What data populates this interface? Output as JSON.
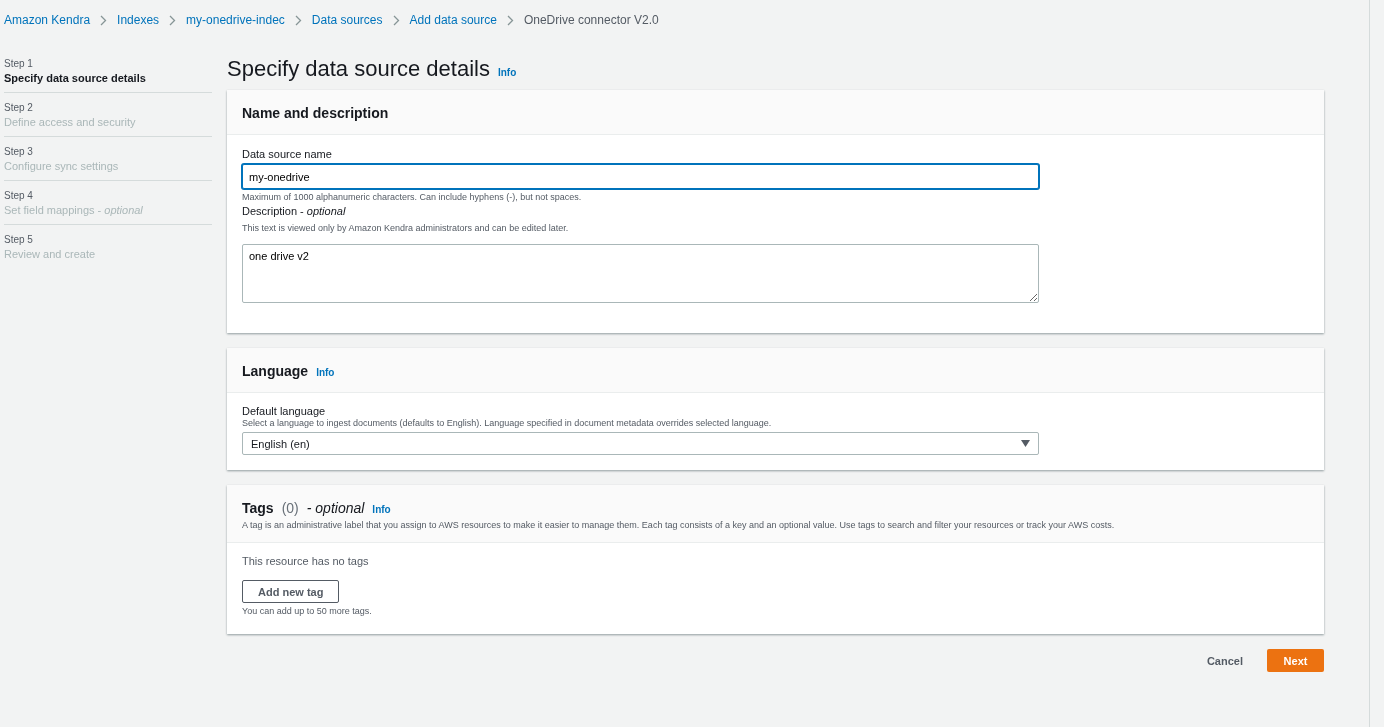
{
  "breadcrumbs": [
    {
      "label": "Amazon Kendra",
      "link": true
    },
    {
      "label": "Indexes",
      "link": true
    },
    {
      "label": "my-onedrive-indec",
      "link": true
    },
    {
      "label": "Data sources",
      "link": true
    },
    {
      "label": "Add data source",
      "link": true
    },
    {
      "label": "OneDrive connector V2.0",
      "link": false
    }
  ],
  "steps": [
    {
      "step": "Step 1",
      "title": "Specify data source details",
      "selected": true
    },
    {
      "step": "Step 2",
      "title": "Define access and security",
      "selected": false
    },
    {
      "step": "Step 3",
      "title": "Configure sync settings",
      "selected": false
    },
    {
      "step": "Step 4",
      "title": "Set field mappings - *optional*",
      "selected": false
    },
    {
      "step": "Step 5",
      "title": "Review and create",
      "selected": false
    }
  ],
  "page_title": "Specify data source details",
  "page_info": "Info",
  "name_section": {
    "title": "Name and description",
    "name_label": "Data source name",
    "name_value": "my-onedrive",
    "name_hint": "Maximum of 1000 alphanumeric characters. Can include hyphens (-), but not spaces.",
    "description_label": "Description - *optional*",
    "description_hint": "This text is viewed only by Amazon Kendra administrators and can be edited later.",
    "description_value": "one drive v2"
  },
  "language_section": {
    "title": "Language",
    "info": "Info",
    "label": "Default language",
    "hint": "Select a language to ingest documents (defaults to English). Language specified in document metadata overrides selected language.",
    "value": "English (en)"
  },
  "tags_section": {
    "title": "Tags",
    "count": "(0)",
    "optional": "- optional",
    "info": "Info",
    "description": "A tag is an administrative label that you assign to AWS resources to make it easier to manage them. Each tag consists of a key and an optional value. Use tags to search and filter your resources or track your AWS costs.",
    "empty": "This resource has no tags",
    "add_button": "Add new tag",
    "limit": "You can add up to 50 more tags."
  },
  "actions": {
    "cancel": "Cancel",
    "next": "Next"
  }
}
